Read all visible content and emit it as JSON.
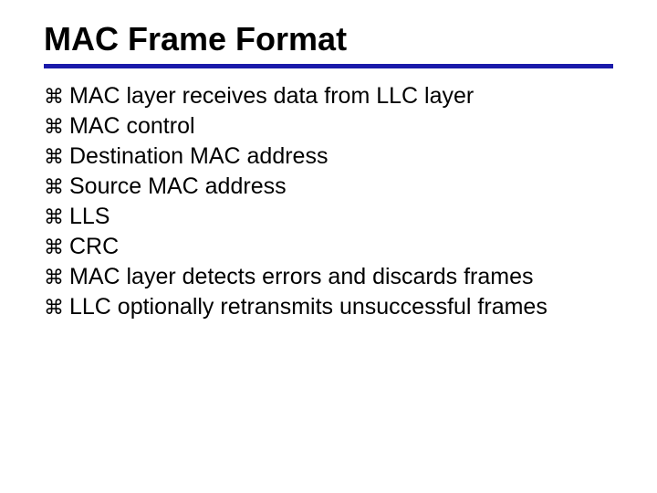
{
  "slide": {
    "title": "MAC Frame Format",
    "bullets": [
      "MAC layer receives data from LLC layer",
      "MAC control",
      "Destination MAC address",
      "Source MAC address",
      "LLS",
      "CRC",
      "MAC layer detects errors and discards frames",
      "LLC optionally retransmits unsuccessful frames"
    ],
    "bullet_glyph": "⌘"
  }
}
